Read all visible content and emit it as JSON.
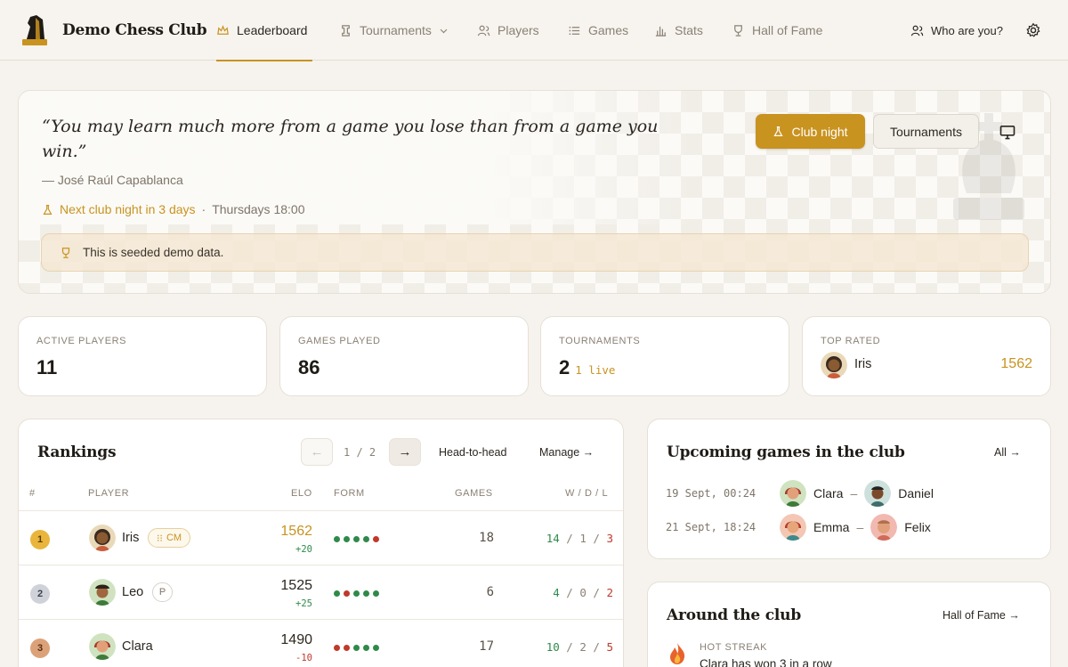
{
  "nav": {
    "brand": "Demo Chess Club",
    "items": [
      {
        "label": "Leaderboard",
        "icon": "crown-icon"
      },
      {
        "label": "Tournaments",
        "icon": "rook-icon"
      },
      {
        "label": "Players",
        "icon": "users-icon"
      },
      {
        "label": "Games",
        "icon": "list-icon"
      },
      {
        "label": "Stats",
        "icon": "bar-chart-icon"
      },
      {
        "label": "Hall of Fame",
        "icon": "trophy-icon"
      }
    ],
    "who": "Who are you?"
  },
  "hero": {
    "quote": "“You may learn much more from a game you lose than from a game you win.”",
    "author": "— José Raúl Capablanca",
    "next_night": "Next club night in 3 days",
    "separator": "·",
    "schedule": "Thursdays 18:00",
    "banner": "This is seeded demo data.",
    "club_night_btn": "Club night",
    "tournaments_btn": "Tournaments"
  },
  "stats": {
    "active_label": "ACTIVE PLAYERS",
    "active_value": "11",
    "games_label": "GAMES PLAYED",
    "games_value": "86",
    "tourn_label": "TOURNAMENTS",
    "tourn_value": "2",
    "tourn_live": "1 live",
    "top_label": "TOP RATED",
    "top_name": "Iris",
    "top_rating": "1562"
  },
  "rankings": {
    "title": "Rankings",
    "prev": "←",
    "next": "→",
    "page": "1 / 2",
    "h2h": "Head-to-head",
    "manage": "Manage →",
    "headers": {
      "rank": "#",
      "player": "PLAYER",
      "elo": "ELO",
      "form": "FORM",
      "games": "GAMES",
      "wdl": "W / D / L"
    },
    "rows": [
      {
        "rank": "1",
        "name": "Iris",
        "title": "CM",
        "elo": "1562",
        "delta": "+20",
        "form": [
          "W",
          "W",
          "W",
          "W",
          "L"
        ],
        "games": "18",
        "w": "14",
        "d": "1",
        "l": "3"
      },
      {
        "rank": "2",
        "name": "Leo",
        "title": "P",
        "elo": "1525",
        "delta": "+25",
        "form": [
          "W",
          "L",
          "W",
          "W",
          "W"
        ],
        "games": "6",
        "w": "4",
        "d": "0",
        "l": "2"
      },
      {
        "rank": "3",
        "name": "Clara",
        "title": "",
        "elo": "1490",
        "delta": "-10",
        "form": [
          "L",
          "L",
          "W",
          "W",
          "W"
        ],
        "games": "17",
        "w": "10",
        "d": "2",
        "l": "5"
      }
    ]
  },
  "upcoming": {
    "title": "Upcoming games in the club",
    "all": "All →",
    "games": [
      {
        "date": "19 Sept, 00:24",
        "white": "Clara",
        "black": "Daniel",
        "sep": "–"
      },
      {
        "date": "21 Sept, 18:24",
        "white": "Emma",
        "black": "Felix",
        "sep": "–"
      }
    ]
  },
  "around": {
    "title": "Around the club",
    "hof": "Hall of Fame →",
    "item_label": "HOT STREAK",
    "item_text": "Clara has won 3 in a row"
  },
  "colors": {
    "accent": "#c99320",
    "win": "#2f8a4a",
    "loss": "#c0392b"
  }
}
